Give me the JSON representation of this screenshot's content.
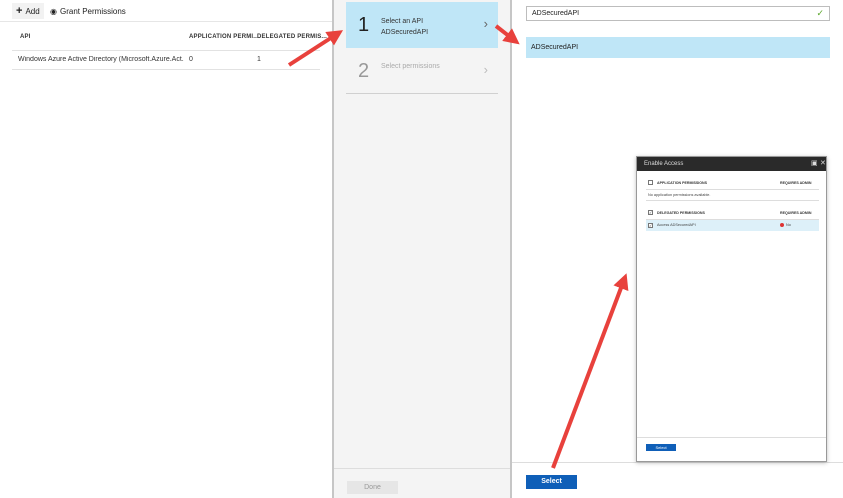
{
  "toolbar": {
    "add_label": "Add",
    "add_icon": "plus-icon",
    "grant_label": "Grant Permissions",
    "grant_icon": "eye-icon"
  },
  "table": {
    "columns": [
      "API",
      "APPLICATION PERMI...",
      "DELEGATED PERMIS..."
    ],
    "rows": [
      {
        "api": "Windows Azure Active Directory (Microsoft.Azure.Act...",
        "application": "0",
        "delegated": "1"
      }
    ]
  },
  "steps": [
    {
      "number": "1",
      "title": "Select an API",
      "value": "ADSecuredAPI"
    },
    {
      "number": "2",
      "title": "Select permissions",
      "value": ""
    }
  ],
  "done_label": "Done",
  "search": {
    "value": "ADSecuredAPI"
  },
  "result_label": "ADSecuredAPI",
  "select_label": "Select",
  "dialog": {
    "title": "Enable Access",
    "app_header": "APPLICATION PERMISSIONS",
    "admin_header": "REQUIRES ADMIN",
    "no_app_text": "No application permissions available.",
    "delegated_header": "DELEGATED PERMISSIONS",
    "permission_label": "Access ADSecuredAPI",
    "requires_admin_value": "No",
    "select_label": "Select"
  },
  "colors": {
    "accent": "#0f5fb8",
    "highlight": "#bfe6f7",
    "arrow": "#e8413c"
  }
}
